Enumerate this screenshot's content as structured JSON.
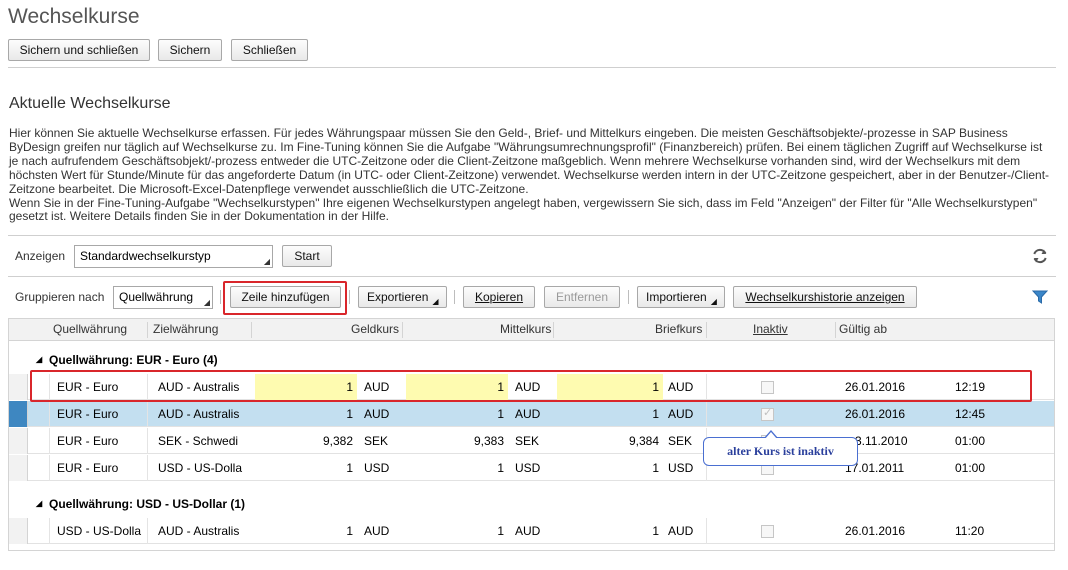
{
  "window": {
    "title": "Wechselkurse"
  },
  "toolbar": {
    "save_close": "Sichern und schließen",
    "save": "Sichern",
    "close": "Schließen"
  },
  "section": {
    "title": "Aktuelle Wechselkurse",
    "desc1": "Hier können Sie aktuelle Wechselkurse erfassen. Für jedes Währungspaar müssen Sie den Geld-, Brief- und Mittelkurs eingeben. Die meisten Geschäftsobjekte/-prozesse in SAP Business ByDesign greifen nur täglich auf Wechselkurse zu. Im Fine-Tuning können Sie die Aufgabe \"Währungsumrechnungsprofil\" (Finanzbereich) prüfen. Bei einem täglichen Zugriff auf Wechselkurse ist je nach aufrufendem Geschäftsobjekt/-prozess entweder die UTC-Zeitzone oder die Client-Zeitzone maßgeblich. Wenn mehrere Wechselkurse vorhanden sind, wird der Wechselkurs mit dem höchsten Wert für Stunde/Minute für das angeforderte Datum (in UTC- oder Client-Zeitzone) verwendet. Wechselkurse werden intern in der UTC-Zeitzone gespeichert, aber in der Benutzer-/Client-Zeitzone bearbeitet. Die Microsoft-Excel-Datenpflege verwendet ausschließlich die UTC-Zeitzone.",
    "desc2": "Wenn Sie in der Fine-Tuning-Aufgabe \"Wechselkurstypen\" Ihre eigenen Wechselkurstypen angelegt haben, vergewissern Sie sich, dass im Feld \"Anzeigen\" der Filter für \"Alle Wechselkurstypen\" gesetzt ist. Weitere Details finden Sie in der Dokumentation in der Hilfe."
  },
  "filter": {
    "label": "Anzeigen",
    "value": "Standardwechselkurstyp",
    "start": "Start"
  },
  "table_toolbar": {
    "group_label": "Gruppieren nach",
    "group_value": "Quellwährung",
    "add_row": "Zeile hinzufügen",
    "export": "Exportieren",
    "copy": "Kopieren",
    "remove": "Entfernen",
    "import": "Importieren",
    "history": "Wechselkurshistorie anzeigen"
  },
  "columns": {
    "source": "Quellwährung",
    "target": "Zielwährung",
    "bid": "Geldkurs",
    "mid": "Mittelkurs",
    "ask": "Briefkurs",
    "inactive": "Inaktiv",
    "valid_from": "Gültig ab"
  },
  "groups": [
    {
      "label": "Quellwährung: EUR - Euro (4)",
      "rows": [
        {
          "source": "EUR - Euro",
          "target": "AUD - Australis",
          "bid": "1",
          "bid_cur": "AUD",
          "mid": "1",
          "mid_cur": "AUD",
          "ask": "1",
          "ask_cur": "AUD",
          "inactive": false,
          "date": "26.01.2016",
          "time": "12:19"
        },
        {
          "source": "EUR - Euro",
          "target": "AUD - Australis",
          "bid": "1",
          "bid_cur": "AUD",
          "mid": "1",
          "mid_cur": "AUD",
          "ask": "1",
          "ask_cur": "AUD",
          "inactive": true,
          "date": "26.01.2016",
          "time": "12:45"
        },
        {
          "source": "EUR - Euro",
          "target": "SEK - Schwedi",
          "bid": "9,382",
          "bid_cur": "SEK",
          "mid": "9,383",
          "mid_cur": "SEK",
          "ask": "9,384",
          "ask_cur": "SEK",
          "inactive": false,
          "date": "3.11.2010",
          "time": "01:00"
        },
        {
          "source": "EUR - Euro",
          "target": "USD - US-Dolla",
          "bid": "1",
          "bid_cur": "USD",
          "mid": "1",
          "mid_cur": "USD",
          "ask": "1",
          "ask_cur": "USD",
          "inactive": false,
          "date": "17.01.2011",
          "time": "01:00"
        }
      ]
    },
    {
      "label": "Quellwährung: USD - US-Dollar (1)",
      "rows": [
        {
          "source": "USD - US-Dolla",
          "target": "AUD - Australis",
          "bid": "1",
          "bid_cur": "AUD",
          "mid": "1",
          "mid_cur": "AUD",
          "ask": "1",
          "ask_cur": "AUD",
          "inactive": false,
          "date": "26.01.2016",
          "time": "11:20"
        }
      ]
    }
  ],
  "tooltip": "alter Kurs ist inaktiv",
  "colors": {
    "selected_row": "#c3dff0",
    "editable_cell": "#fefbb0",
    "highlight_box": "#d9262b",
    "tooltip_border": "#4a6fd1"
  },
  "icons": {
    "refresh": "refresh-icon",
    "filter": "filter-icon"
  }
}
